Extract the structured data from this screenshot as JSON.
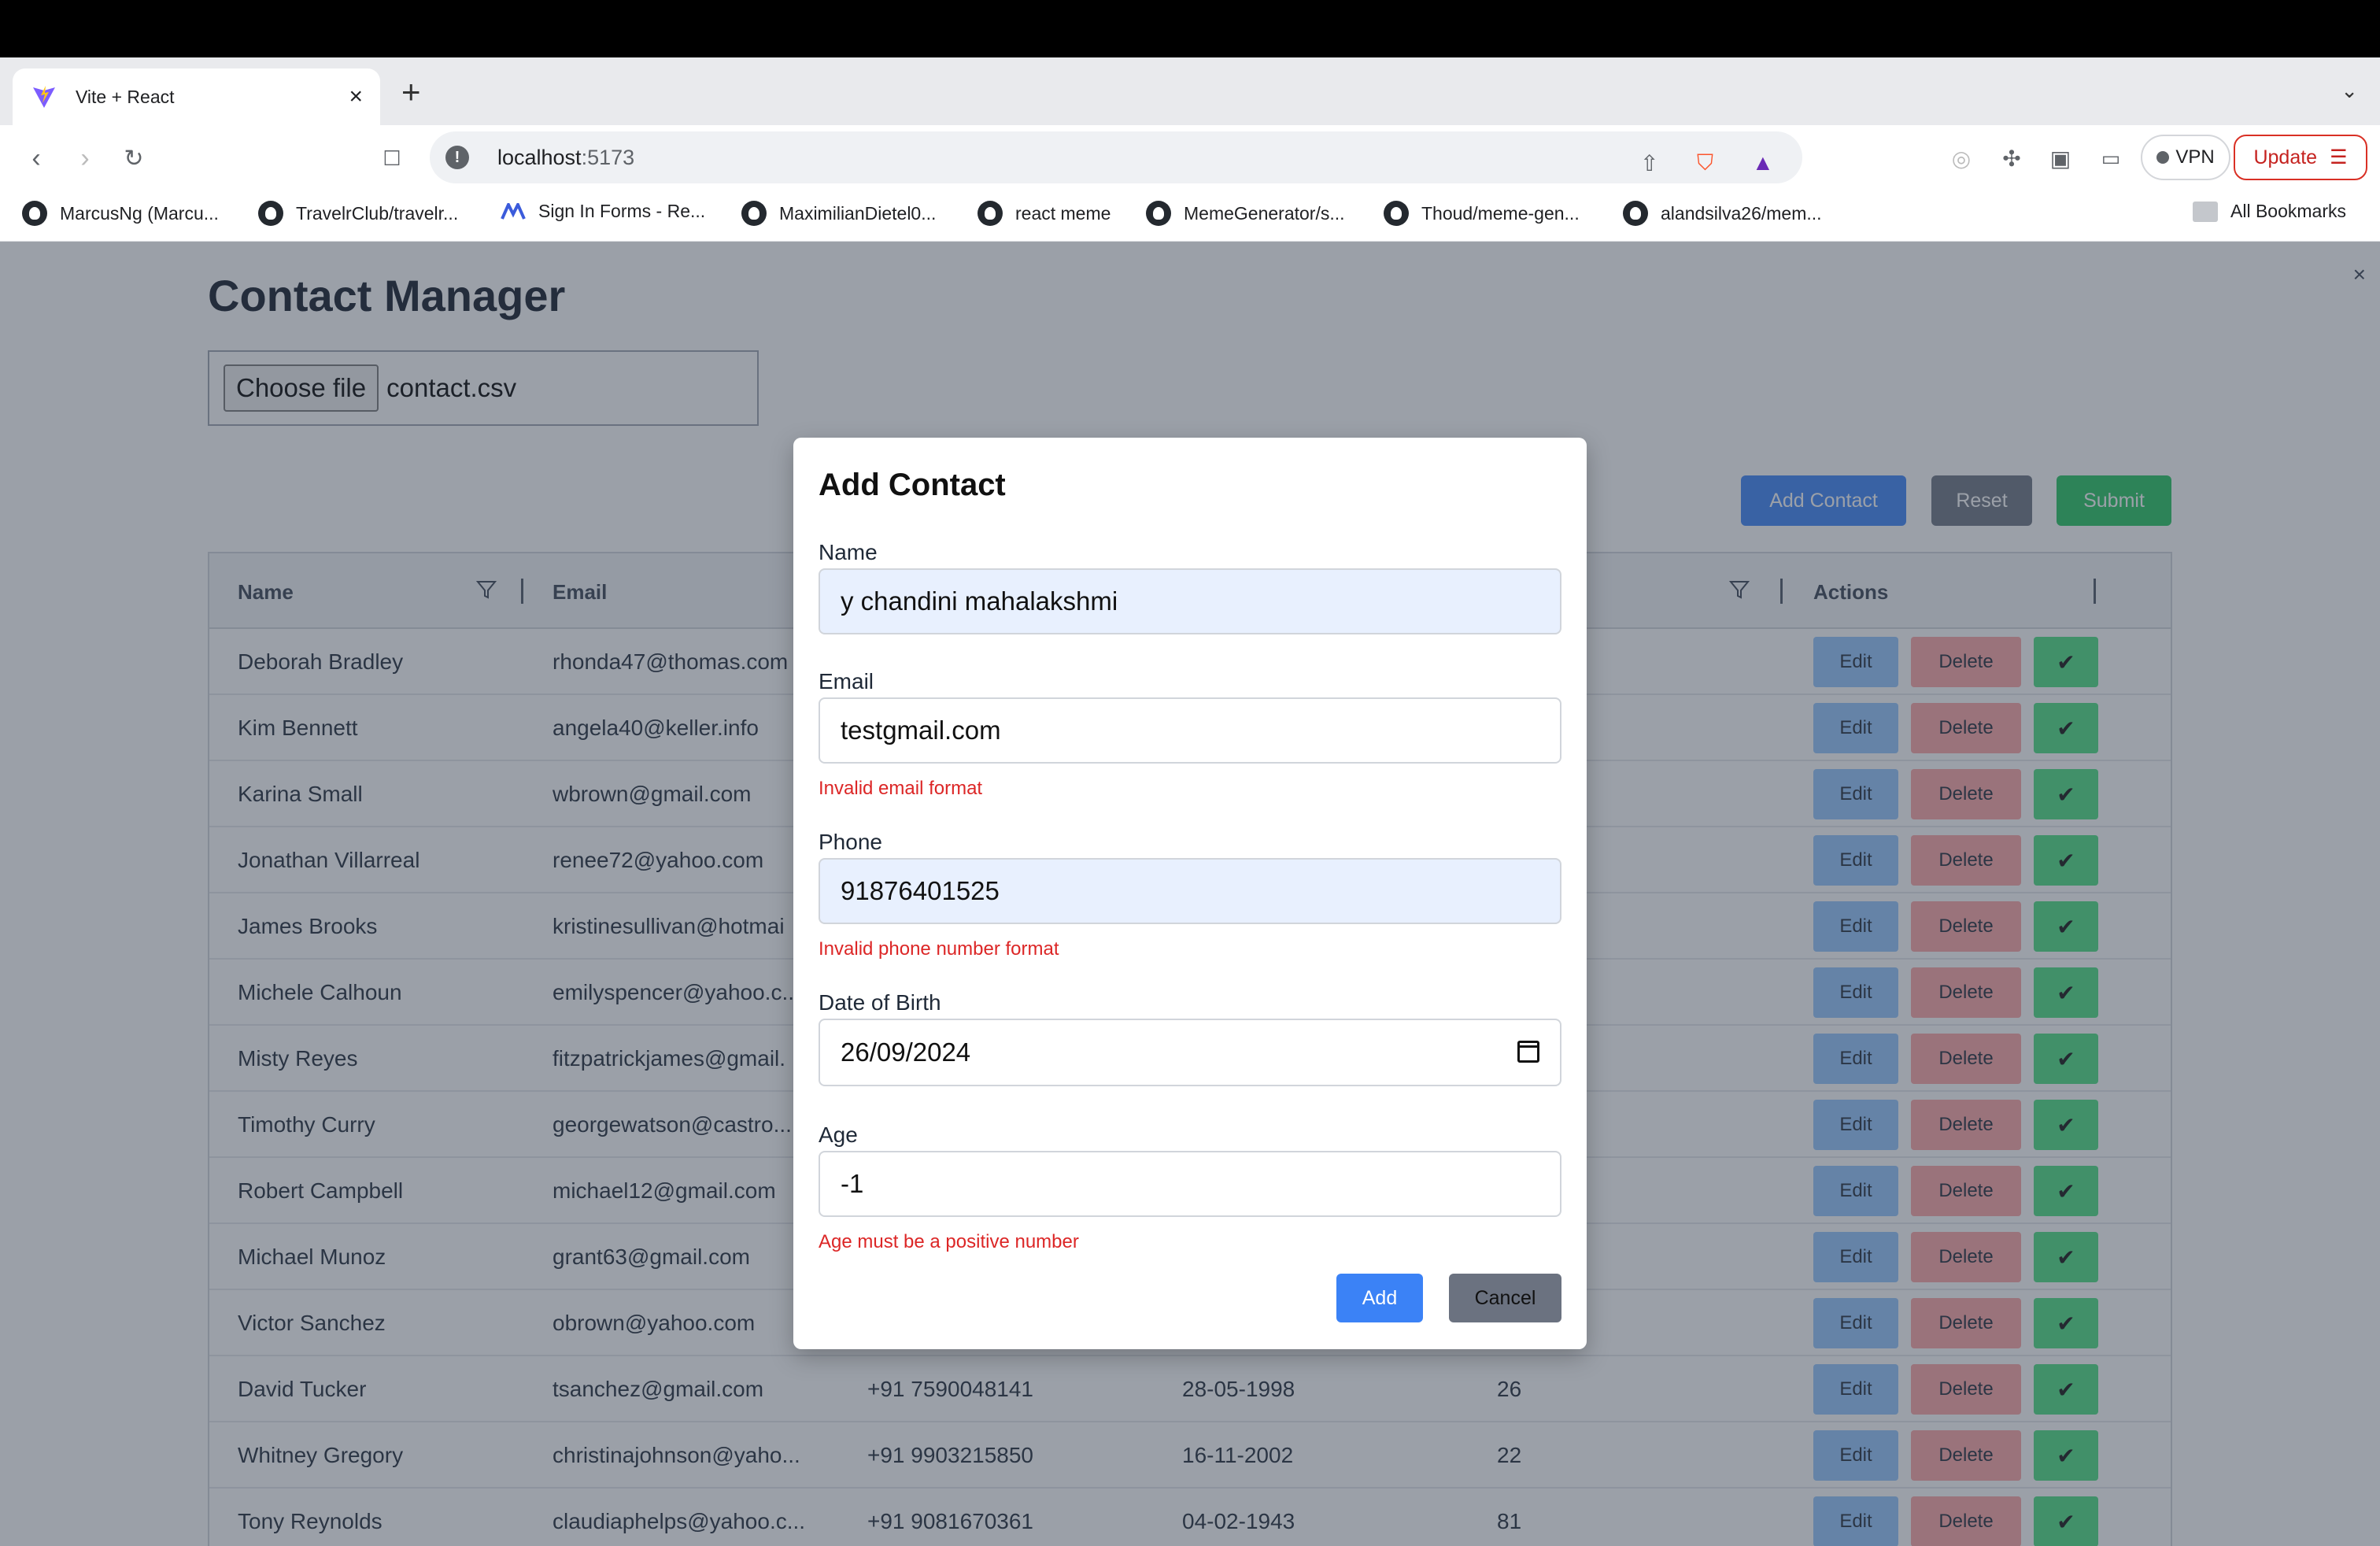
{
  "browser": {
    "tab_title": "Vite + React",
    "new_tab": "+",
    "url_host": "localhost",
    "url_port": ":5173",
    "vpn_label": "VPN",
    "update_label": "Update",
    "bookmarks": [
      "MarcusNg (Marcu...",
      "TravelrClub/travelr...",
      "Sign In Forms - Re...",
      "MaximilianDietel0...",
      "react meme",
      "MemeGenerator/s...",
      "Thoud/meme-gen...",
      "alandsilva26/mem..."
    ],
    "all_bookmarks": "All Bookmarks"
  },
  "page": {
    "title": "Contact Manager",
    "choose_file": "Choose file",
    "file_name": "contact.csv",
    "add_contact": "Add Contact",
    "reset": "Reset",
    "submit": "Submit",
    "overlay_close": "×"
  },
  "table": {
    "headers": {
      "name": "Name",
      "email": "Email",
      "actions": "Actions"
    },
    "edit_label": "Edit",
    "delete_label": "Delete",
    "check_label": "✔",
    "rows": [
      {
        "name": "Deborah Bradley",
        "email": "rhonda47@thomas.com",
        "phone": "",
        "dob": "",
        "age": ""
      },
      {
        "name": "Kim Bennett",
        "email": "angela40@keller.info",
        "phone": "",
        "dob": "",
        "age": ""
      },
      {
        "name": "Karina Small",
        "email": "wbrown@gmail.com",
        "phone": "",
        "dob": "",
        "age": ""
      },
      {
        "name": "Jonathan Villarreal",
        "email": "renee72@yahoo.com",
        "phone": "",
        "dob": "",
        "age": ""
      },
      {
        "name": "James Brooks",
        "email": "kristinesullivan@hotmai",
        "phone": "",
        "dob": "",
        "age": ""
      },
      {
        "name": "Michele Calhoun",
        "email": "emilyspencer@yahoo.c...",
        "phone": "",
        "dob": "",
        "age": ""
      },
      {
        "name": "Misty Reyes",
        "email": "fitzpatrickjames@gmail.",
        "phone": "",
        "dob": "",
        "age": ""
      },
      {
        "name": "Timothy Curry",
        "email": "georgewatson@castro...",
        "phone": "",
        "dob": "",
        "age": ""
      },
      {
        "name": "Robert Campbell",
        "email": "michael12@gmail.com",
        "phone": "",
        "dob": "",
        "age": ""
      },
      {
        "name": "Michael Munoz",
        "email": "grant63@gmail.com",
        "phone": "",
        "dob": "",
        "age": ""
      },
      {
        "name": "Victor Sanchez",
        "email": "obrown@yahoo.com",
        "phone": "",
        "dob": "",
        "age": ""
      },
      {
        "name": "David Tucker",
        "email": "tsanchez@gmail.com",
        "phone": "+91 7590048141",
        "dob": "28-05-1998",
        "age": "26"
      },
      {
        "name": "Whitney Gregory",
        "email": "christinajohnson@yaho...",
        "phone": "+91 9903215850",
        "dob": "16-11-2002",
        "age": "22"
      },
      {
        "name": "Tony Reynolds",
        "email": "claudiaphelps@yahoo.c...",
        "phone": "+91 9081670361",
        "dob": "04-02-1943",
        "age": "81"
      }
    ]
  },
  "modal": {
    "title": "Add Contact",
    "name_label": "Name",
    "name_value": "y chandini mahalakshmi",
    "email_label": "Email",
    "email_value": "testgmail.com",
    "email_error": "Invalid email format",
    "phone_label": "Phone",
    "phone_value": "91876401525",
    "phone_error": "Invalid phone number format",
    "dob_label": "Date of Birth",
    "dob_value": "26/09/2024",
    "age_label": "Age",
    "age_value": "-1",
    "age_error": "Age must be a positive number",
    "add_label": "Add",
    "cancel_label": "Cancel"
  }
}
